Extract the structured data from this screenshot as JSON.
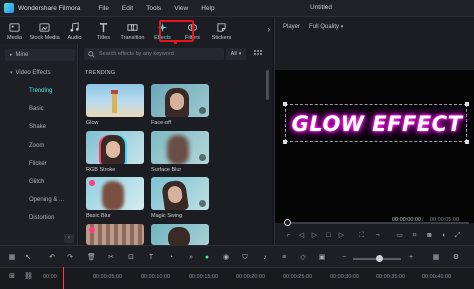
{
  "app": {
    "name": "Wondershare Filmora",
    "document_title": "Untitled"
  },
  "menu": [
    "File",
    "Edit",
    "Tools",
    "View",
    "Help"
  ],
  "tabs": [
    {
      "label": "Media",
      "icon": "media-icon"
    },
    {
      "label": "Stock Media",
      "icon": "stock-media-icon"
    },
    {
      "label": "Audio",
      "icon": "audio-icon"
    },
    {
      "label": "Titles",
      "icon": "titles-icon"
    },
    {
      "label": "Transition",
      "icon": "transition-icon"
    },
    {
      "label": "Effects",
      "icon": "effects-icon",
      "active": true
    },
    {
      "label": "Filters",
      "icon": "filters-icon"
    },
    {
      "label": "Stickers",
      "icon": "stickers-icon"
    }
  ],
  "sidebar": {
    "items": [
      "Mine",
      "Video Effects",
      "Trending",
      "Basic",
      "Shake",
      "Zoom",
      "Flicker",
      "Glitch",
      "Opening & ...",
      "Distortion"
    ],
    "selected": "Trending"
  },
  "effects_panel": {
    "search_placeholder": "Search effects by any keyword",
    "filter_value": "All",
    "section": "TRENDING",
    "cards": [
      {
        "label": "Glow"
      },
      {
        "label": "Face-off"
      },
      {
        "label": "RGB Stroke"
      },
      {
        "label": "Surface Blur"
      },
      {
        "label": "Basic Blur"
      },
      {
        "label": "Magic Swing"
      }
    ]
  },
  "player": {
    "label": "Player",
    "quality": "Full Quality",
    "preview_text": "GLOW EFFECT",
    "current_time": "00:00:00:00",
    "separator": "/",
    "total_time": "00:00:05:00"
  },
  "ruler": {
    "ticks": [
      "00:00",
      "00:00:05:00",
      "00:00:10:00",
      "00:00:15:00",
      "00:00:20:00",
      "00:00:25:00",
      "00:00:30:00",
      "00:00:35:00",
      "00:00:40:00"
    ]
  },
  "colors": {
    "accent": "#4fe3e3",
    "highlight": "#e8141c",
    "glow": "#ff1fe6",
    "background": "#16181c"
  }
}
